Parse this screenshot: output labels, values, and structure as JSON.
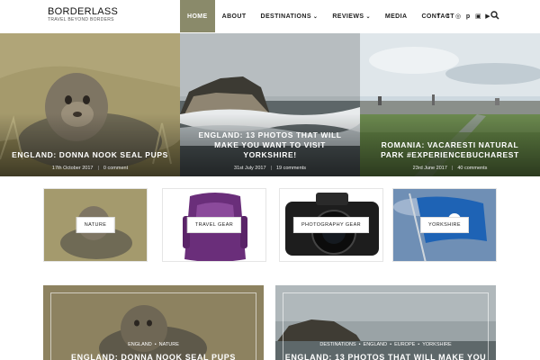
{
  "brand": {
    "title": "BORDERLASS",
    "tagline": "TRAVEL BEYOND BORDERS"
  },
  "nav": {
    "home": "HOME",
    "about": "ABOUT",
    "destinations": "DESTINATIONS",
    "reviews": "REVIEWS",
    "media": "MEDIA",
    "contact": "CONTACT",
    "dropdown_glyph": "⌄"
  },
  "social": {
    "facebook": "f",
    "twitter": "t",
    "instagram": "◎",
    "pinterest": "p",
    "flickr": "▣",
    "youtube": "▶"
  },
  "hero": [
    {
      "title": "ENGLAND: DONNA NOOK SEAL PUPS",
      "date": "17th October 2017",
      "comments": "0 comment"
    },
    {
      "title": "ENGLAND: 13 PHOTOS THAT WILL MAKE YOU WANT TO VISIT YORKSHIRE!",
      "date": "31st July 2017",
      "comments": "19 comments"
    },
    {
      "title": "ROMANIA: VACARESTI NATURAL PARK #EXPERIENCEBUCHAREST",
      "date": "23rd June 2017",
      "comments": "40 comments"
    }
  ],
  "categories": [
    {
      "label": "NATURE"
    },
    {
      "label": "TRAVEL GEAR"
    },
    {
      "label": "PHOTOGRAPHY GEAR"
    },
    {
      "label": "YORKSHIRE"
    }
  ],
  "posts": [
    {
      "tags": [
        "ENGLAND",
        "NATURE"
      ],
      "title": "ENGLAND: DONNA NOOK SEAL PUPS"
    },
    {
      "tags": [
        "DESTINATIONS",
        "ENGLAND",
        "EUROPE",
        "YORKSHIRE"
      ],
      "title": "ENGLAND: 13 PHOTOS THAT WILL MAKE YOU"
    }
  ],
  "colors": {
    "accent": "#8a8a6a",
    "text": "#222222"
  }
}
